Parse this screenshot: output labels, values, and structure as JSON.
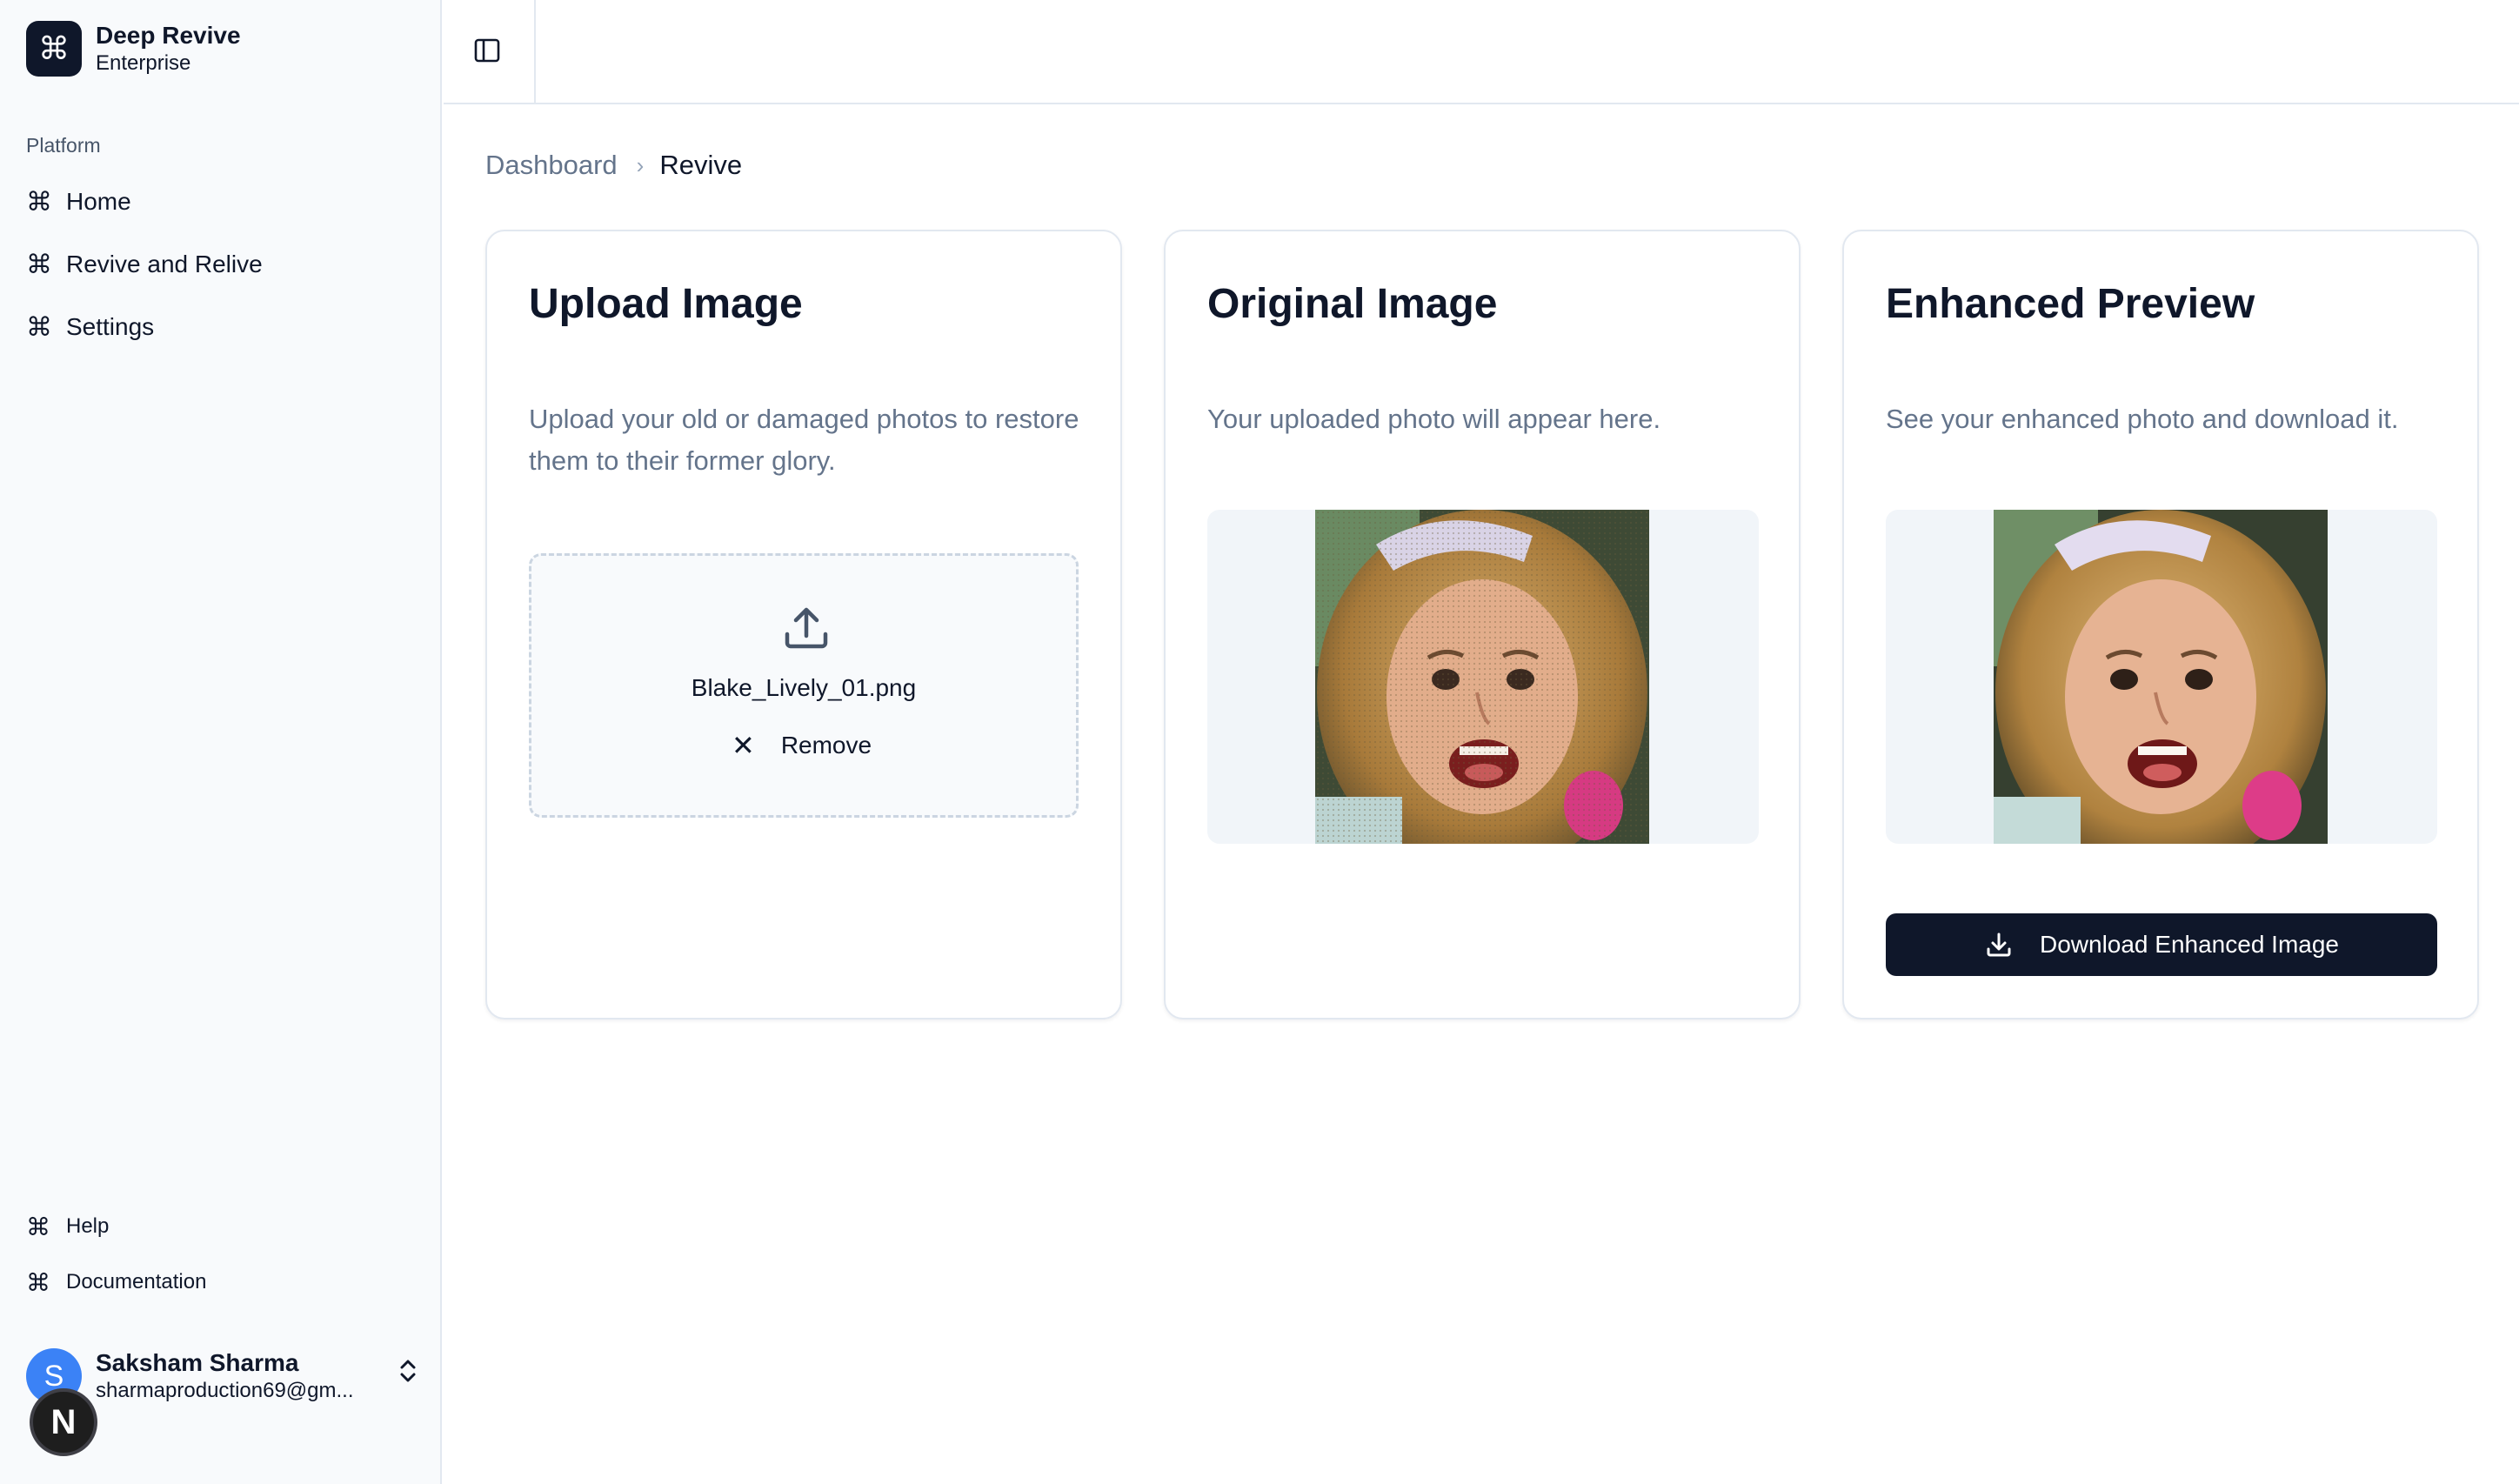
{
  "sidebar": {
    "brand": {
      "name": "Deep Revive",
      "subtitle": "Enterprise",
      "logo_icon": "command-icon"
    },
    "group_label": "Platform",
    "nav": [
      {
        "label": "Home",
        "icon": "command-icon"
      },
      {
        "label": "Revive and Relive",
        "icon": "command-icon"
      },
      {
        "label": "Settings",
        "icon": "command-icon"
      }
    ],
    "secondary": [
      {
        "label": "Help",
        "icon": "command-icon"
      },
      {
        "label": "Documentation",
        "icon": "command-icon"
      }
    ],
    "user": {
      "initial": "S",
      "name": "Saksham Sharma",
      "email": "sharmaproduction69@gm..."
    },
    "next_badge": "N"
  },
  "topbar": {
    "toggle_icon": "sidebar-toggle-icon"
  },
  "breadcrumb": {
    "parent": "Dashboard",
    "current": "Revive"
  },
  "cards": {
    "upload": {
      "title": "Upload Image",
      "description": "Upload your old or damaged photos to restore them to their former glory.",
      "file_name": "Blake_Lively_01.png",
      "remove_label": "Remove"
    },
    "original": {
      "title": "Original Image",
      "description": "Your uploaded photo will appear here."
    },
    "enhanced": {
      "title": "Enhanced Preview",
      "description": "See your enhanced photo and download it.",
      "download_label": "Download Enhanced Image"
    }
  },
  "colors": {
    "primary": "#0f172a",
    "muted_text": "#64748b",
    "border": "#e2e8f0",
    "avatar": "#3b82f6"
  }
}
